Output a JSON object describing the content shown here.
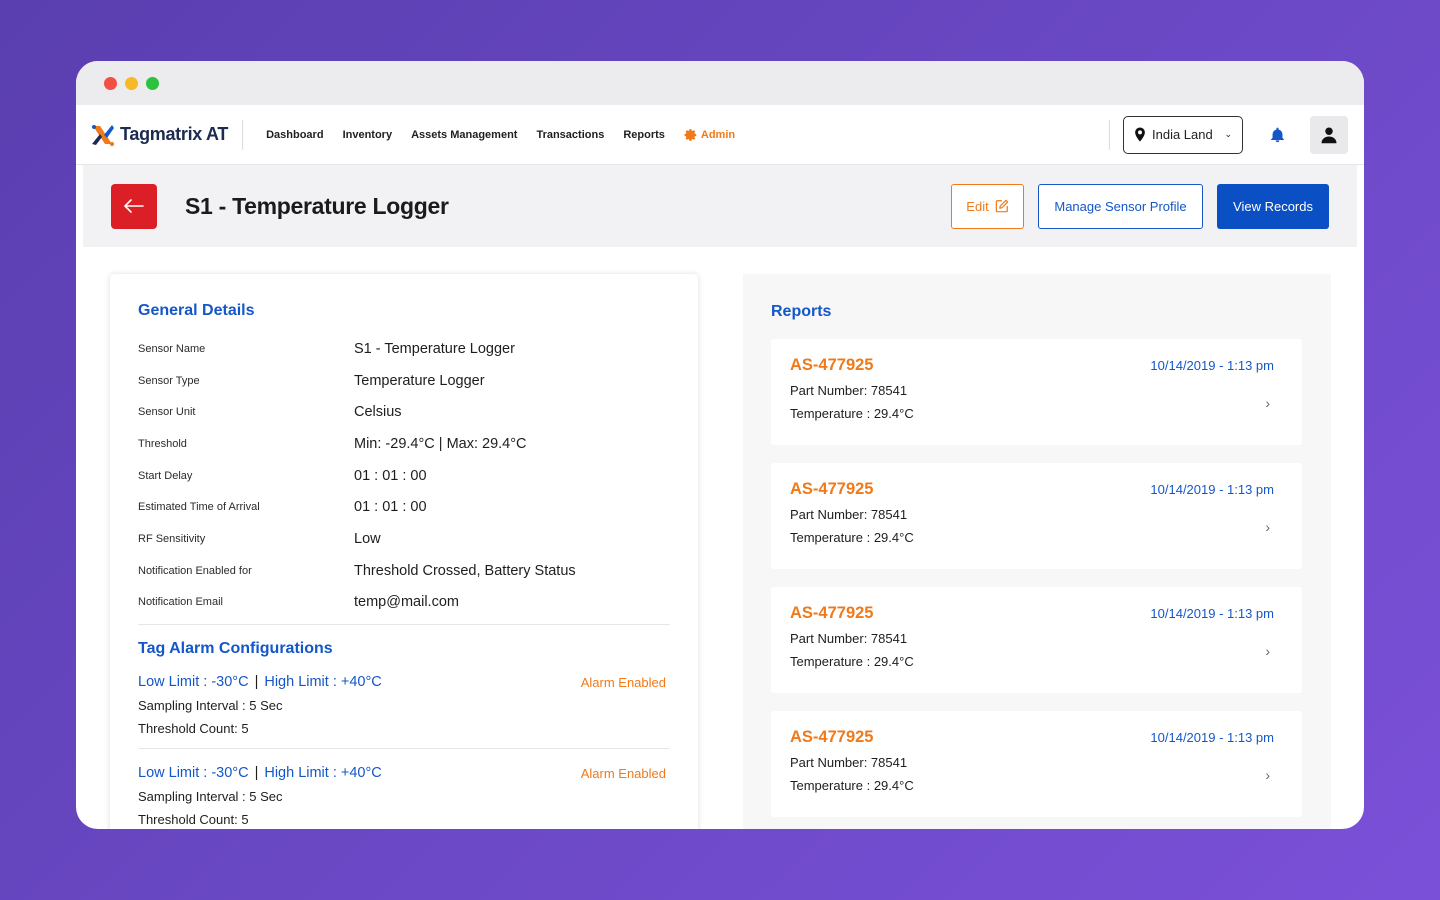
{
  "nav": {
    "logo_text": "Tagmatrix AT",
    "links": [
      "Dashboard",
      "Inventory",
      "Assets Management",
      "Transactions",
      "Reports"
    ],
    "admin_label": "Admin",
    "location": "India Land"
  },
  "header": {
    "title": "S1 - Temperature Logger",
    "edit_label": "Edit",
    "manage_label": "Manage Sensor Profile",
    "view_label": "View Records"
  },
  "general": {
    "title": "General Details",
    "rows": [
      {
        "label": "Sensor Name",
        "value": "S1 - Temperature Logger"
      },
      {
        "label": "Sensor Type",
        "value": "Temperature Logger"
      },
      {
        "label": "Sensor Unit",
        "value": "Celsius"
      },
      {
        "label": "Threshold",
        "value": "Min: -29.4°C | Max: 29.4°C"
      },
      {
        "label": "Start Delay",
        "value": "01 : 01 : 00"
      },
      {
        "label": "Estimated Time of Arrival",
        "value": "01 : 01 : 00"
      },
      {
        "label": "RF Sensitivity",
        "value": "Low"
      },
      {
        "label": "Notification Enabled for",
        "value": "Threshold Crossed, Battery Status"
      },
      {
        "label": "Notification Email",
        "value": "temp@mail.com"
      }
    ]
  },
  "tag_alarms": {
    "title": "Tag Alarm Configurations",
    "items": [
      {
        "low": "Low Limit : -30°C",
        "sep": "|",
        "high": "High Limit : +40°C",
        "status": "Alarm Enabled",
        "sampling": "Sampling Interval : 5 Sec",
        "count": "Threshold Count: 5"
      },
      {
        "low": "Low Limit : -30°C",
        "sep": "|",
        "high": "High Limit : +40°C",
        "status": "Alarm Enabled",
        "sampling": "Sampling Interval : 5 Sec",
        "count": "Threshold Count: 5"
      }
    ]
  },
  "reports": {
    "title": "Reports",
    "items": [
      {
        "id": "AS-477925",
        "date": "10/14/2019 - 1:13 pm",
        "part": "Part Number: 78541",
        "temp": "Temperature : 29.4°C"
      },
      {
        "id": "AS-477925",
        "date": "10/14/2019 - 1:13 pm",
        "part": "Part Number: 78541",
        "temp": "Temperature : 29.4°C"
      },
      {
        "id": "AS-477925",
        "date": "10/14/2019 - 1:13 pm",
        "part": "Part Number: 78541",
        "temp": "Temperature : 29.4°C"
      },
      {
        "id": "AS-477925",
        "date": "10/14/2019 - 1:13 pm",
        "part": "Part Number: 78541",
        "temp": "Temperature : 29.4°C"
      }
    ]
  },
  "colors": {
    "brand_blue": "#1457c8",
    "accent_orange": "#f07a1a",
    "danger_red": "#dc1f26"
  }
}
